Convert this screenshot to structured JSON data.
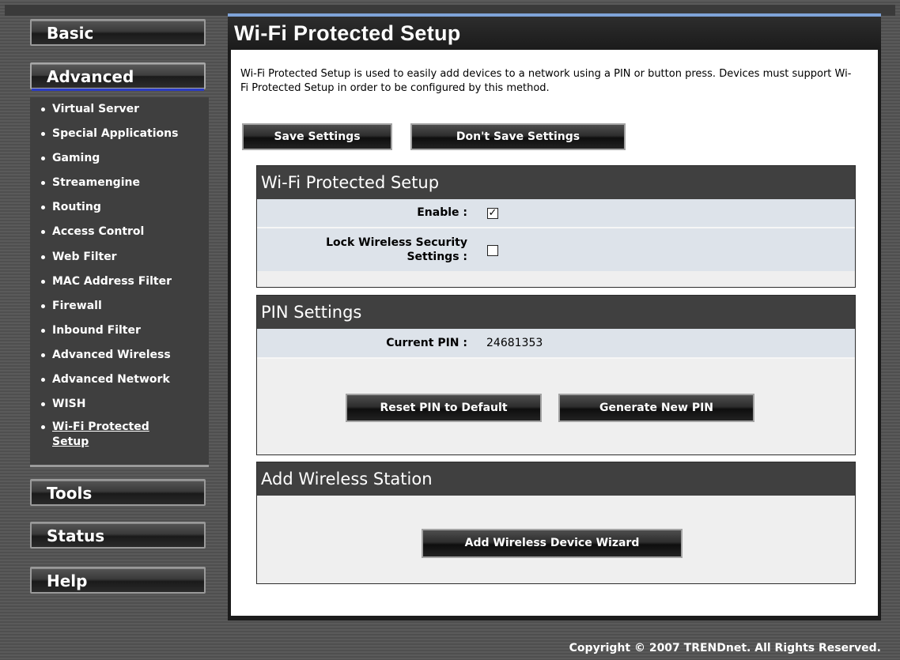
{
  "sidebar": {
    "nav": {
      "basic": "Basic",
      "advanced": "Advanced",
      "tools": "Tools",
      "status": "Status",
      "help": "Help"
    },
    "advanced_items": [
      {
        "label": "Virtual Server"
      },
      {
        "label": "Special Applications"
      },
      {
        "label": "Gaming"
      },
      {
        "label": "Streamengine"
      },
      {
        "label": "Routing"
      },
      {
        "label": "Access Control"
      },
      {
        "label": "Web Filter"
      },
      {
        "label": "MAC Address Filter"
      },
      {
        "label": "Firewall"
      },
      {
        "label": "Inbound Filter"
      },
      {
        "label": "Advanced Wireless"
      },
      {
        "label": "Advanced Network"
      },
      {
        "label": "WISH"
      },
      {
        "label": "Wi-Fi Protected Setup"
      }
    ]
  },
  "main": {
    "title": "Wi-Fi Protected Setup",
    "description": "Wi-Fi Protected Setup is used to easily add devices to a network using a PIN or button press. Devices must support Wi-Fi Protected Setup in order to be configured by this method.",
    "save_label": "Save Settings",
    "dont_save_label": "Don't Save Settings",
    "wps_section": {
      "title": "Wi-Fi Protected Setup",
      "enable_label": "Enable :",
      "enable_checked": true,
      "lock_label": "Lock Wireless Security Settings :",
      "lock_checked": false
    },
    "pin_section": {
      "title": "PIN Settings",
      "current_pin_label": "Current PIN :",
      "current_pin_value": "24681353",
      "reset_label": "Reset PIN to Default",
      "generate_label": "Generate New PIN"
    },
    "station_section": {
      "title": "Add Wireless Station",
      "wizard_label": "Add Wireless Device Wizard"
    }
  },
  "footer": {
    "copyright": "Copyright © 2007 TRENDnet. All Rights Reserved."
  }
}
